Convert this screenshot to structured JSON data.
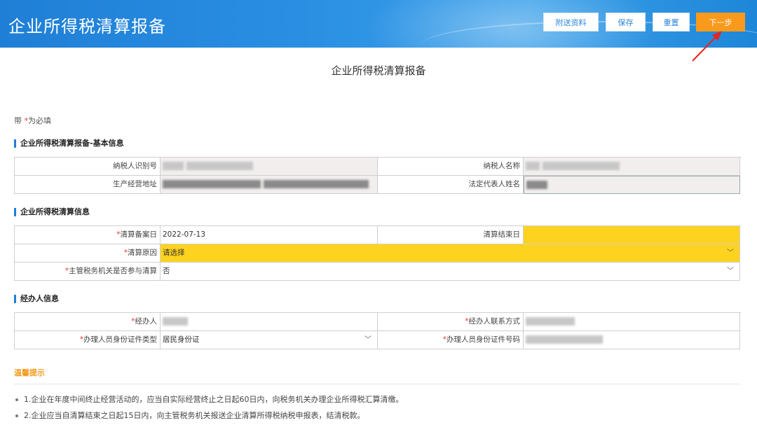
{
  "header": {
    "title": "企业所得税清算报备",
    "buttons": {
      "attach": "附送资料",
      "save": "保存",
      "reset": "重置",
      "next": "下一步"
    }
  },
  "page_title": "企业所得税清算报备",
  "required_note": {
    "prefix": "带 ",
    "star": "*",
    "suffix": "为必填"
  },
  "sections": {
    "basic": {
      "title": "企业所得税清算报备-基本信息",
      "taxpayer_id_label": "纳税人识别号",
      "taxpayer_name_label": "纳税人名称",
      "address_label": "生产经营地址",
      "legal_rep_label": "法定代表人姓名"
    },
    "liquidation": {
      "title": "企业所得税清算信息",
      "filing_date_label": "清算备案日",
      "filing_date_value": "2022-07-13",
      "end_date_label": "清算结束日",
      "reason_label": "清算原因",
      "reason_value": "请选择",
      "authority_label": "主管税务机关是否参与清算",
      "authority_value": "否"
    },
    "agent": {
      "title": "经办人信息",
      "agent_label": "经办人",
      "contact_label": "经办人联系方式",
      "id_type_label": "办理人员身份证件类型",
      "id_type_value": "居民身份证",
      "id_number_label": "办理人员身份证件号码"
    }
  },
  "tips": {
    "title": "温馨提示",
    "items": [
      "1.企业在年度中间终止经营活动的，应当自实际经营终止之日起60日内，向税务机关办理企业所得税汇算清缴。",
      "2.企业应当自清算结束之日起15日内，向主管税务机关报送企业清算所得税纳税申报表，结清税款。"
    ]
  },
  "colors": {
    "header_blue": "#1f7fd6",
    "accent_orange": "#f99a1c",
    "required_yellow": "#fdd31f",
    "readonly_grey": "#f2eeee",
    "arrow_red": "#e8231e"
  }
}
